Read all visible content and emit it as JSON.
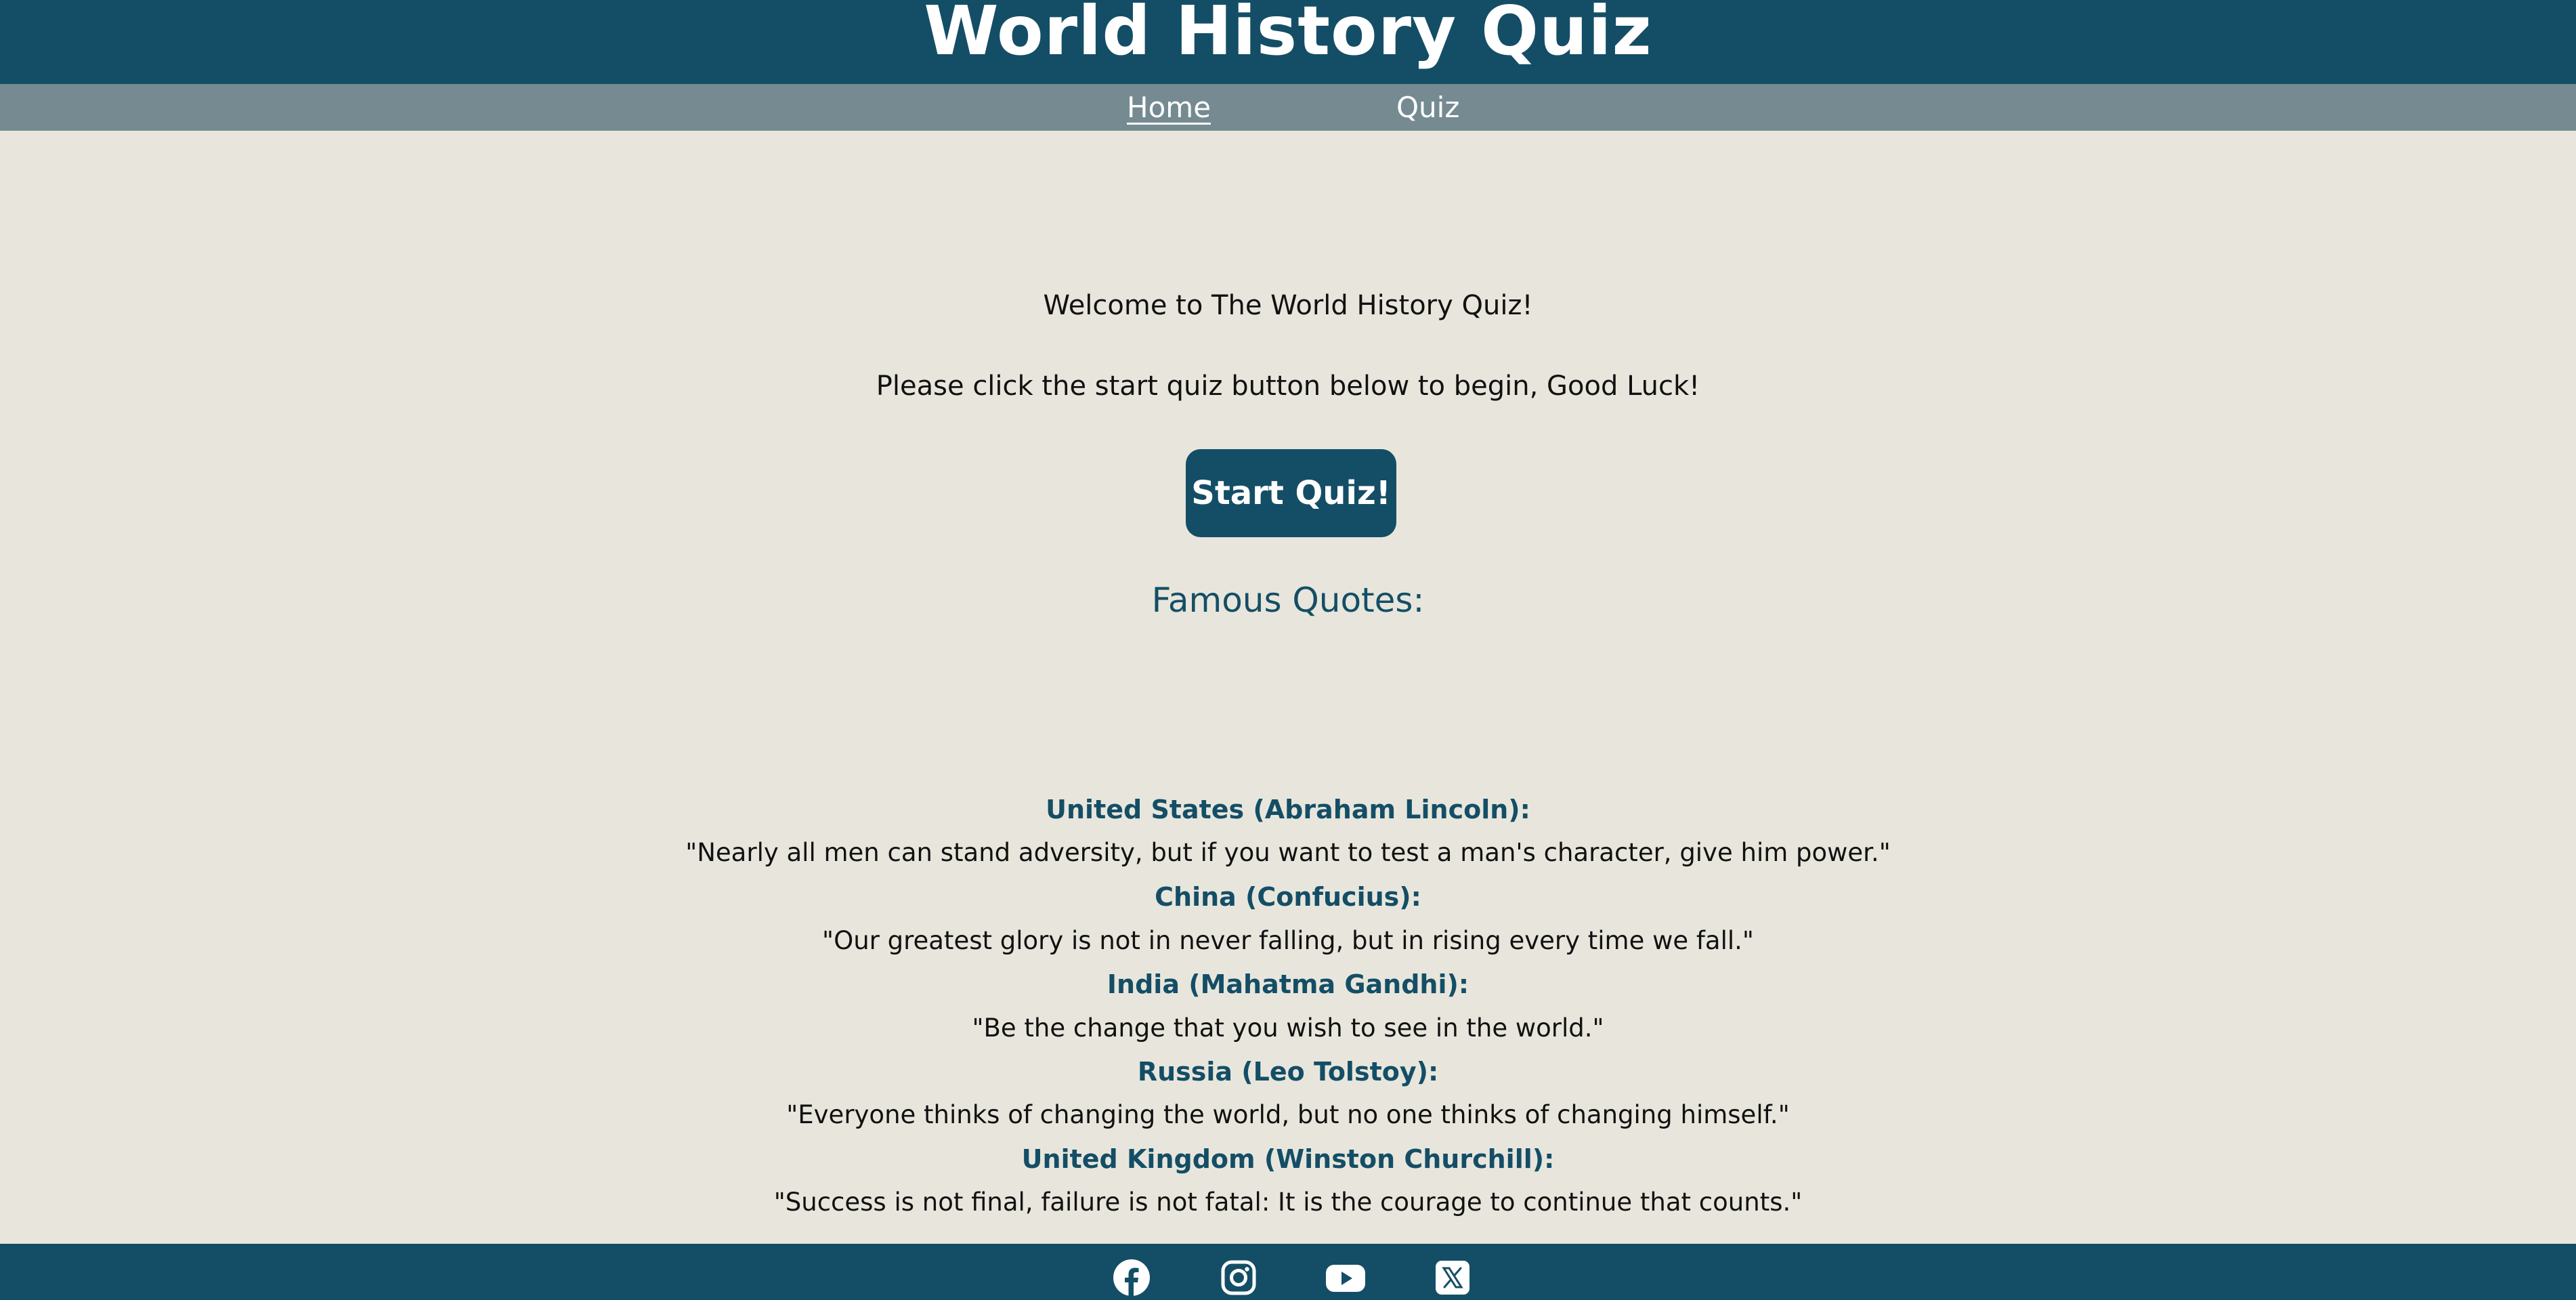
{
  "header": {
    "title": "World History Quiz"
  },
  "nav": {
    "items": [
      {
        "label": "Home",
        "active": true
      },
      {
        "label": "Quiz",
        "active": false
      }
    ]
  },
  "main": {
    "welcome": "Welcome to The World History Quiz!",
    "instructions": "Please click the start quiz button below to begin, Good Luck!",
    "start_button_label": "Start Quiz!",
    "quotes_heading": "Famous Quotes:",
    "quotes": [
      {
        "source": "United States (Abraham Lincoln):",
        "text": "\"Nearly all men can stand adversity, but if you want to test a man's character, give him power.\""
      },
      {
        "source": "China (Confucius):",
        "text": "\"Our greatest glory is not in never falling, but in rising every time we fall.\""
      },
      {
        "source": "India (Mahatma Gandhi):",
        "text": "\"Be the change that you wish to see in the world.\""
      },
      {
        "source": "Russia (Leo Tolstoy):",
        "text": "\"Everyone thinks of changing the world, but no one thinks of changing himself.\""
      },
      {
        "source": "United Kingdom (Winston Churchill):",
        "text": "\"Success is not final, failure is not fatal: It is the courage to continue that counts.\""
      }
    ]
  },
  "footer": {
    "social_icons": [
      "facebook-icon",
      "instagram-icon",
      "youtube-icon",
      "x-twitter-icon"
    ]
  },
  "colors": {
    "primary": "#144e66",
    "nav_bar": "#758b91",
    "background": "#e8e6dc",
    "text": "#111111",
    "on_primary": "#ffffff"
  }
}
